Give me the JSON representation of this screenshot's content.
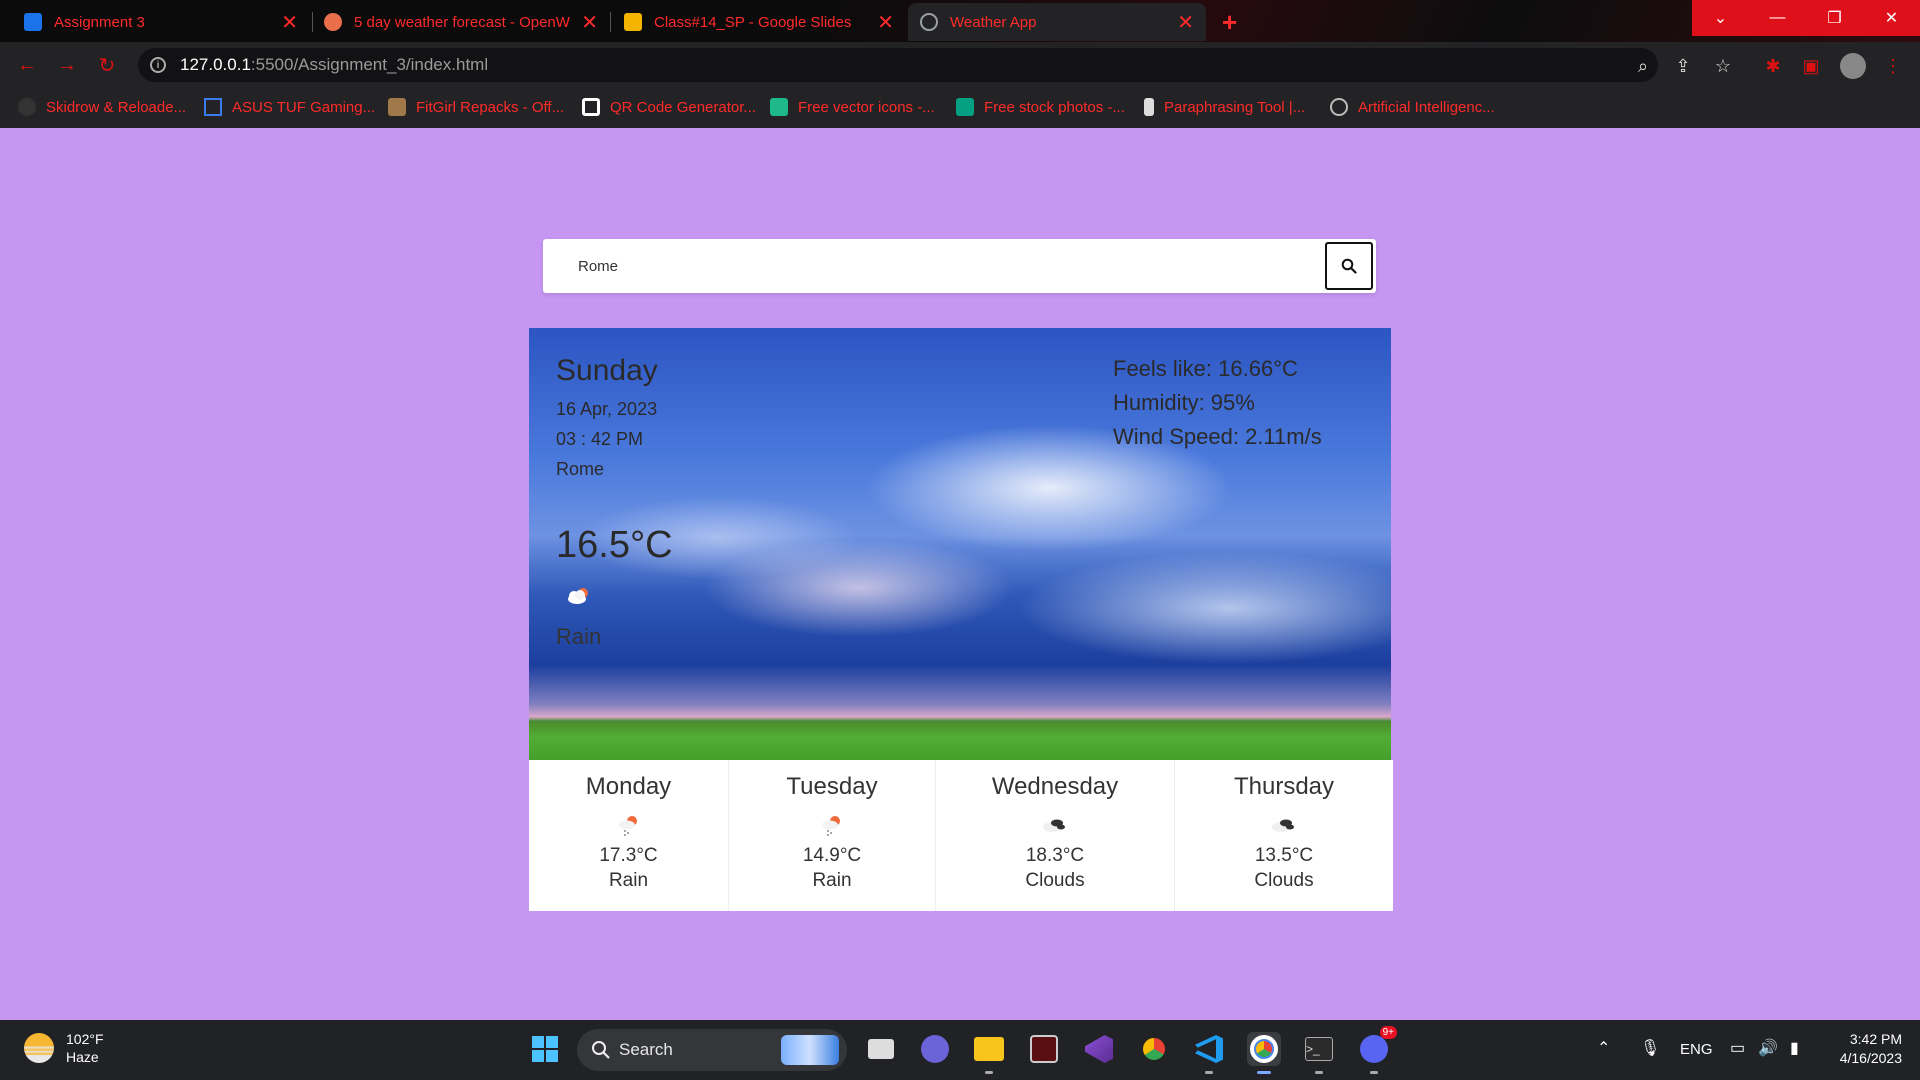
{
  "browser": {
    "tabs": [
      {
        "title": "Assignment 3",
        "icon": "google-classroom-icon",
        "color": "#1a73e8"
      },
      {
        "title": "5 day weather forecast - OpenW",
        "icon": "openweather-icon",
        "color": "#eb6e4b"
      },
      {
        "title": "Class#14_SP - Google Slides",
        "icon": "google-slides-icon",
        "color": "#f4b400"
      },
      {
        "title": "Weather App",
        "icon": "globe-icon",
        "color": "#9aa0a6"
      }
    ],
    "url_host": "127.0.0.1",
    "url_path": ":5500/Assignment_3/index.html",
    "bookmarks": [
      {
        "label": "Skidrow & Reloade...",
        "icon": "skull-icon"
      },
      {
        "label": "ASUS TUF Gaming...",
        "icon": "asus-icon"
      },
      {
        "label": "FitGirl Repacks - Off...",
        "icon": "fitgirl-icon"
      },
      {
        "label": "QR Code Generator...",
        "icon": "qr-icon"
      },
      {
        "label": "Free vector icons -...",
        "icon": "vector-icon"
      },
      {
        "label": "Free stock photos -...",
        "icon": "pexels-icon"
      },
      {
        "label": "Paraphrasing Tool |...",
        "icon": "quill-icon"
      },
      {
        "label": "Artificial Intelligenc...",
        "icon": "globe-icon"
      }
    ],
    "accent": "#ff2a2a"
  },
  "search": {
    "value": "Rome",
    "button_icon": "search-icon"
  },
  "current": {
    "day": "Sunday",
    "date": "16 Apr, 2023",
    "time": "03 : 42 PM",
    "city": "Rome",
    "temp": "16.5°C",
    "icon": "rain-cloud-icon",
    "desc": "Rain",
    "feels_like": "Feels like: 16.66°C",
    "humidity": "Humidity: 95%",
    "wind": "Wind Speed: 2.11m/s"
  },
  "forecast": [
    {
      "day": "Monday",
      "temp": "17.3°C",
      "desc": "Rain",
      "icon": "rain-icon"
    },
    {
      "day": "Tuesday",
      "temp": "14.9°C",
      "desc": "Rain",
      "icon": "rain-icon"
    },
    {
      "day": "Wednesday",
      "temp": "18.3°C",
      "desc": "Clouds",
      "icon": "clouds-icon"
    },
    {
      "day": "Thursday",
      "temp": "13.5°C",
      "desc": "Clouds",
      "icon": "clouds-icon"
    }
  ],
  "taskbar": {
    "weather_temp": "102°F",
    "weather_desc": "Haze",
    "search_label": "Search",
    "apps": [
      "start-icon",
      "task-view-icon",
      "teams-icon",
      "file-explorer-icon",
      "game-app-icon",
      "visual-studio-icon",
      "chrome-canary-icon",
      "vscode-icon",
      "chrome-icon",
      "terminal-icon",
      "discord-icon"
    ],
    "discord_badge": "9+",
    "lang": "ENG",
    "time": "3:42 PM",
    "date": "4/16/2023"
  }
}
